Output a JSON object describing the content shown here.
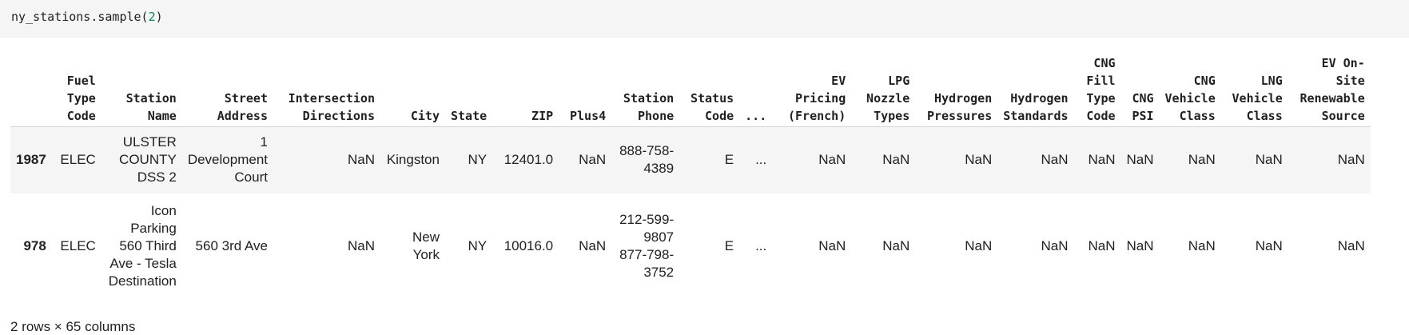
{
  "cell": {
    "code_prefix": "ny_stations.sample(",
    "code_arg": "2",
    "code_suffix": ")"
  },
  "table": {
    "columns": [
      "",
      "Fuel Type Code",
      "Station Name",
      "Street Address",
      "Intersection Directions",
      "City",
      "State",
      "ZIP",
      "Plus4",
      "Station Phone",
      "Status Code",
      "...",
      "EV Pricing (French)",
      "LPG Nozzle Types",
      "Hydrogen Pressures",
      "Hydrogen Standards",
      "CNG Fill Type Code",
      "CNG PSI",
      "CNG Vehicle Class",
      "LNG Vehicle Class",
      "EV On-Site Renewable Source"
    ],
    "rows": [
      {
        "index": "1987",
        "cells": [
          "ELEC",
          "ULSTER COUNTY DSS 2",
          "1 Development Court",
          "NaN",
          "Kingston",
          "NY",
          "12401.0",
          "NaN",
          "888-758-4389",
          "E",
          "...",
          "NaN",
          "NaN",
          "NaN",
          "NaN",
          "NaN",
          "NaN",
          "NaN",
          "NaN",
          "NaN"
        ]
      },
      {
        "index": "978",
        "cells": [
          "ELEC",
          "Icon Parking 560 Third Ave - Tesla Destination",
          "560 3rd Ave",
          "NaN",
          "New York",
          "NY",
          "10016.0",
          "NaN",
          "212-599-9807 877-798-3752",
          "E",
          "...",
          "NaN",
          "NaN",
          "NaN",
          "NaN",
          "NaN",
          "NaN",
          "NaN",
          "NaN",
          "NaN"
        ]
      }
    ]
  },
  "footer": {
    "shape_text": "2 rows × 65 columns"
  }
}
